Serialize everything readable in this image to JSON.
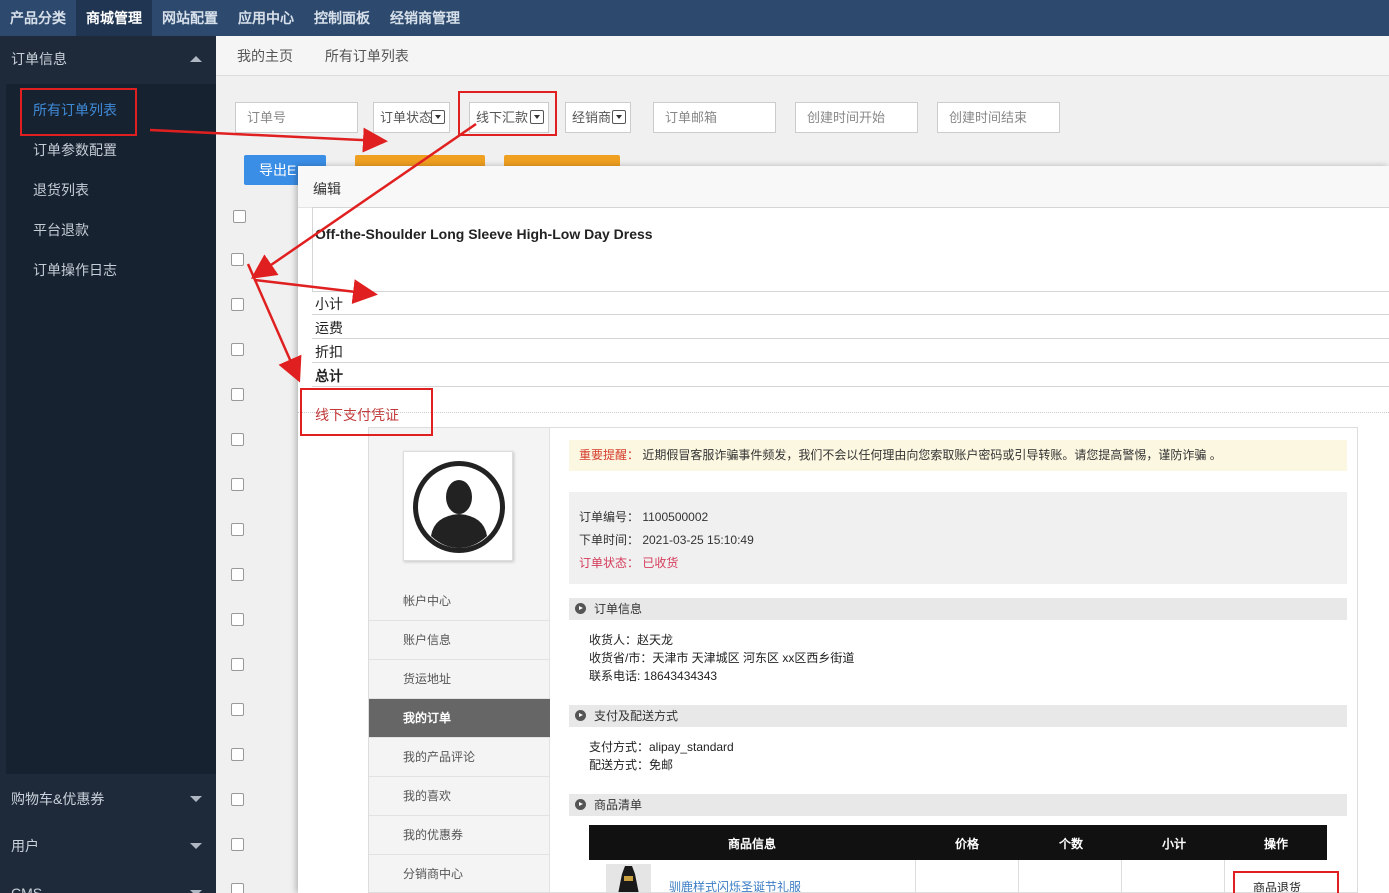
{
  "topnav": {
    "items": [
      "产品分类",
      "商城管理",
      "网站配置",
      "应用中心",
      "控制面板",
      "经销商管理"
    ],
    "active_index": 1
  },
  "sidebar": {
    "group1": "订单信息",
    "links": [
      "所有订单列表",
      "订单参数配置",
      "退货列表",
      "平台退款",
      "订单操作日志"
    ],
    "group2": "购物车&优惠券",
    "group3": "用户",
    "group4": "CMS"
  },
  "breadcrumb": {
    "home": "我的主页",
    "current": "所有订单列表"
  },
  "filters": {
    "order_no": "订单号",
    "order_status": "订单状态",
    "offline_summary": "线下汇款",
    "distributor": "经销商",
    "order_email": "订单邮箱",
    "created_start": "创建时间开始",
    "created_end": "创建时间结束"
  },
  "toolbar": {
    "export_label": "导出E"
  },
  "modal": {
    "title": "编辑",
    "product_title": "Off-the-Shoulder Long Sleeve High-Low Day Dress",
    "subtotal": "小计",
    "shipping": "运费",
    "discount": "折扣",
    "total": "总计",
    "offline_proof": "线下支付凭证"
  },
  "embed": {
    "nav": [
      "帐户中心",
      "账户信息",
      "货运地址",
      "我的订单",
      "我的产品评论",
      "我的喜欢",
      "我的优惠券",
      "分销商中心"
    ],
    "active_nav_index": 3,
    "notice_label": "重要提醒：",
    "notice_text": "近期假冒客服诈骗事件频发，我们不会以任何理由向您索取账户密码或引导转账。请您提高警惕，谨防诈骗 。",
    "order_no": "订单编号： 1100500002",
    "order_time": "下单时间： 2021-03-25 15:10:49",
    "order_status": "订单状态： 已收货",
    "sec_order_info": "订单信息",
    "consignee": "收货人：赵天龙",
    "region": "收货省/市：天津市 天津城区 河东区 xx区西乡街道",
    "phone": "联系电话: 18643434343",
    "sec_payment": "支付及配送方式",
    "pay_method": "支付方式：alipay_standard",
    "ship_method": "配送方式：免邮",
    "sec_goods": "商品清单",
    "table_headers": [
      "商品信息",
      "价格",
      "个数",
      "小计",
      "操作"
    ],
    "product_name": "驯鹿样式闪烁圣诞节礼服",
    "return_action": "商品退货"
  },
  "colors": {
    "topnav_bg": "#2d4a6e",
    "sidebar_bg": "#1e2a3a",
    "active_link": "#3f8bd8",
    "annotation_red": "#e02020",
    "export_button": "#3a8ee6",
    "orange_button": "#f0a020"
  }
}
